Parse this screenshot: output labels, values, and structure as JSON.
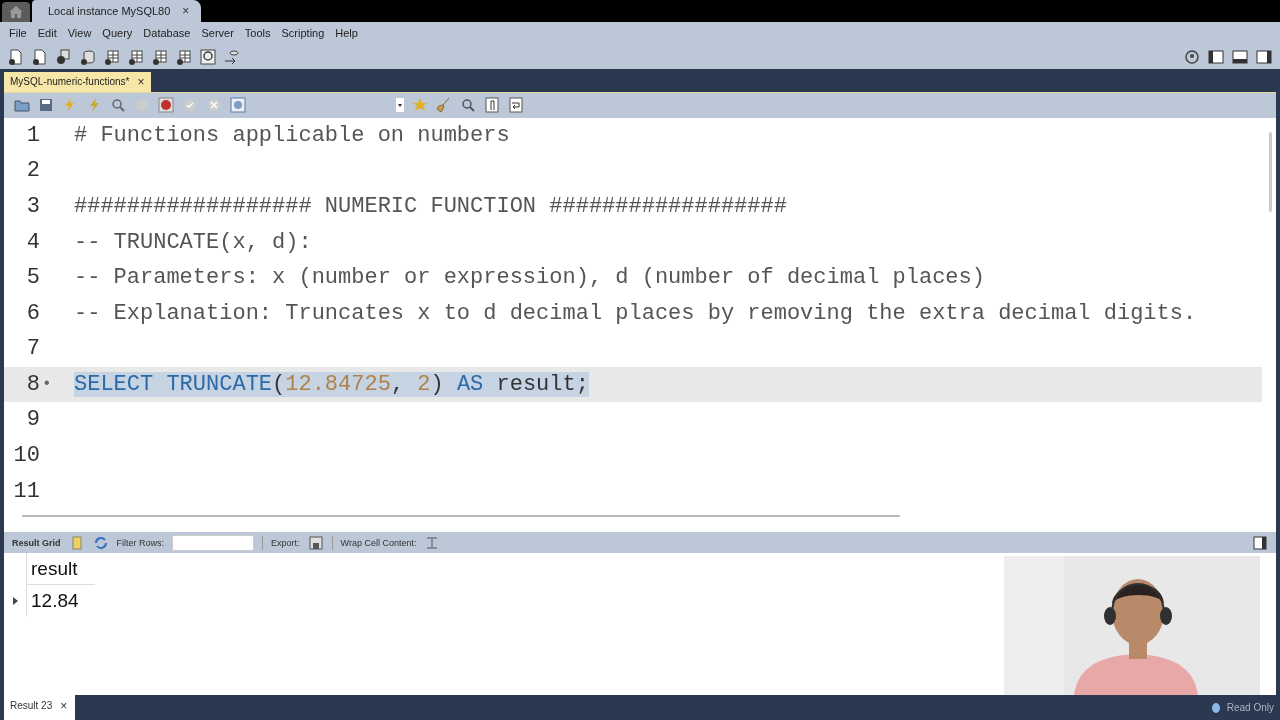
{
  "window_tabs": [
    {
      "label": "Local instance MySQL80",
      "close": "×",
      "selected": true
    }
  ],
  "menu": [
    "File",
    "Edit",
    "View",
    "Query",
    "Database",
    "Server",
    "Tools",
    "Scripting",
    "Help"
  ],
  "file_tab": {
    "label": "MySQL-numeric-functions*",
    "close": "×"
  },
  "editor": {
    "lines": [
      {
        "number": "1",
        "selected": false,
        "tokens": [
          {
            "kind": "comment",
            "text": "# Functions applicable on numbers"
          }
        ]
      },
      {
        "number": "2",
        "selected": false
      },
      {
        "number": "3",
        "selected": false,
        "tokens": [
          {
            "kind": "comment",
            "text": "################## NUMERIC FUNCTION ##################"
          }
        ]
      },
      {
        "number": "4",
        "selected": false,
        "tokens": [
          {
            "kind": "comment",
            "text": "-- TRUNCATE(x, d):"
          }
        ]
      },
      {
        "number": "5",
        "selected": false,
        "tokens": [
          {
            "kind": "comment",
            "text": "-- Parameters: x (number or expression), d (number of decimal places)"
          }
        ]
      },
      {
        "number": "6",
        "selected": false,
        "tokens": [
          {
            "kind": "comment",
            "text": "-- Explanation: Truncates x to d decimal places by removing the extra decimal digits."
          }
        ]
      },
      {
        "number": "7",
        "selected": false
      },
      {
        "number": "8",
        "marker": "•",
        "selected": true,
        "tokens": [
          {
            "kind": "keyword",
            "text": "SELECT "
          },
          {
            "kind": "keyword",
            "text": "TRUNCATE"
          },
          {
            "kind": "plain",
            "text": "("
          },
          {
            "kind": "number",
            "text": "12.84725"
          },
          {
            "kind": "plain",
            "text": ", "
          },
          {
            "kind": "number",
            "text": "2"
          },
          {
            "kind": "plain",
            "text": ") "
          },
          {
            "kind": "keyword",
            "text": "AS"
          },
          {
            "kind": "plain",
            "text": " result;"
          }
        ]
      },
      {
        "number": "9",
        "selected": false
      },
      {
        "number": "10",
        "selected": false
      },
      {
        "number": "11",
        "selected": false
      }
    ]
  },
  "result_toolbar": {
    "grid_label": "Result Grid",
    "filter_label": "Filter Rows:",
    "export_label": "Export:",
    "wrap_label": "Wrap Cell Content:"
  },
  "result_grid": {
    "columns": [
      "result"
    ],
    "rows": [
      [
        "12.84"
      ]
    ]
  },
  "status_bar": {
    "result_tab": {
      "label": "Result 23",
      "close": "×"
    },
    "mode": "Read Only"
  }
}
